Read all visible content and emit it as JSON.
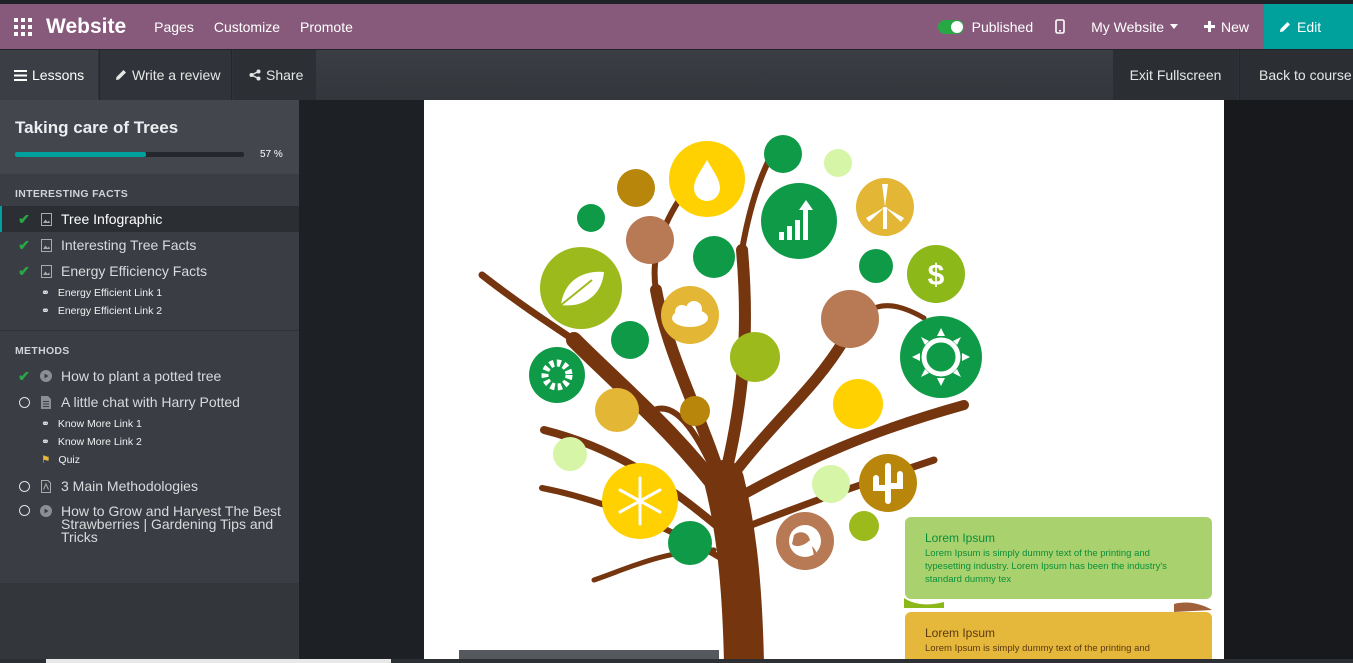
{
  "topbar": {
    "apps_icon": "grid-icon",
    "brand": "Website",
    "menu": [
      "Pages",
      "Customize",
      "Promote"
    ],
    "published": "Published",
    "site": "My Website",
    "new": "New",
    "edit": "Edit",
    "colors": {
      "bar": "#875a7b",
      "edit": "#00a09d"
    }
  },
  "subbar": {
    "lessons": "Lessons",
    "review": "Write a review",
    "share": "Share",
    "exit": "Exit Fullscreen",
    "back": "Back to course"
  },
  "course": {
    "title": "Taking care of Trees",
    "progress_label": "57 %",
    "progress_value": 57
  },
  "sections": {
    "facts": {
      "title": "INTERESTING FACTS",
      "lessons": [
        {
          "label": "Tree Infographic",
          "state": "done",
          "type": "image"
        },
        {
          "label": "Interesting Tree Facts",
          "state": "done",
          "type": "image"
        },
        {
          "label": "Energy Efficiency Facts",
          "state": "done",
          "type": "image"
        }
      ],
      "links": [
        "Energy Efficient Link 1",
        "Energy Efficient Link 2"
      ]
    },
    "methods": {
      "title": "METHODS",
      "lessons": [
        {
          "label": "How to plant a potted tree",
          "state": "done",
          "type": "video"
        },
        {
          "label": "A little chat with Harry Potted",
          "state": "todo",
          "type": "document"
        },
        {
          "label": "3 Main Methodologies",
          "state": "todo",
          "type": "pdf"
        },
        {
          "label": "How to Grow and Harvest The Best Strawberries | Gardening Tips and Tricks",
          "state": "todo",
          "type": "video"
        }
      ],
      "links": [
        "Know More Link 1",
        "Know More Link 2"
      ],
      "quiz": "Quiz"
    }
  },
  "slide": {
    "cards": [
      {
        "title": "Lorem Ipsum",
        "text": "Lorem Ipsum is simply dummy text of the printing and typesetting industry. Lorem Ipsum has been the industry's standard dummy tex"
      },
      {
        "title": "Lorem Ipsum",
        "text": "Lorem Ipsum is simply dummy text of the printing and"
      }
    ]
  }
}
